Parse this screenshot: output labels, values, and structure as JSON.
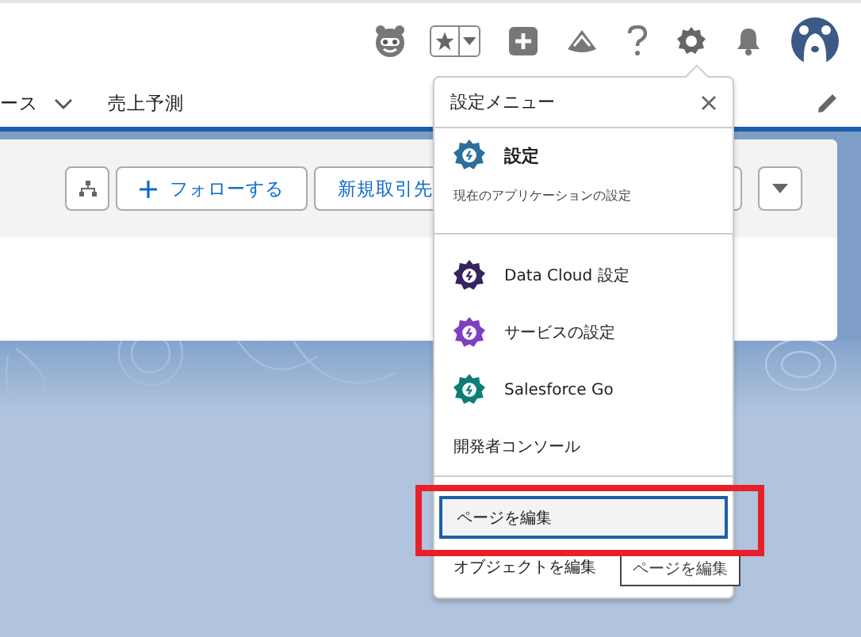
{
  "nav": {
    "items": [
      {
        "label": "ース",
        "dropdown": true
      },
      {
        "label": "売上予測",
        "dropdown": false
      }
    ]
  },
  "actions": {
    "buttons": [
      {
        "kind": "icon"
      },
      {
        "kind": "follow",
        "label": "フォローする"
      },
      {
        "kind": "text",
        "label": "新規取引先"
      },
      {
        "kind": "menu"
      }
    ]
  },
  "setup_menu": {
    "title": "設定メニュー",
    "sections": [
      [
        {
          "kind": "main",
          "label": "設定",
          "description": "現在のアプリケーションの設定",
          "color": "#2b6f9a"
        }
      ],
      [
        {
          "kind": "app",
          "label": "Data Cloud 設定",
          "color": "#35235f"
        },
        {
          "kind": "app",
          "label": "サービスの設定",
          "color": "#7e3fc0"
        },
        {
          "kind": "app",
          "label": "Salesforce Go",
          "color": "#0d7d78"
        },
        {
          "kind": "text",
          "label": "開発者コンソール"
        }
      ],
      [
        {
          "kind": "text",
          "label": "ページを編集",
          "focused": true
        },
        {
          "kind": "text",
          "label": "オブジェクトを編集",
          "focused": false
        }
      ]
    ]
  },
  "tooltip": {
    "text": "ページを編集"
  },
  "highlight": {
    "shown": true
  }
}
